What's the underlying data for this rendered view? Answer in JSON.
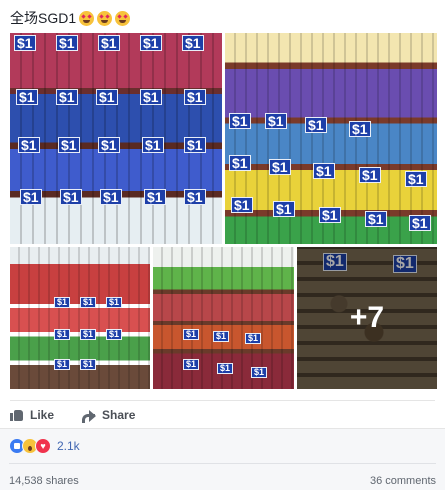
{
  "post": {
    "text": "全场SGD1",
    "emojis": [
      "star-struck",
      "star-struck",
      "star-struck"
    ]
  },
  "photos": {
    "price_tag": "$1",
    "more_count": "+7"
  },
  "actions": {
    "like_label": "Like",
    "share_label": "Share"
  },
  "reactions": {
    "types": [
      "like",
      "wow",
      "love"
    ],
    "count": "2.1k"
  },
  "stats": {
    "shares": "14,538 shares",
    "comments": "36 comments"
  },
  "colors": {
    "tag_blue": "#1d3fa8",
    "link_blue": "#4267b2",
    "like_blue": "#3b7bf2",
    "love_red": "#f0334d",
    "wow_yellow": "#f7c23b"
  }
}
